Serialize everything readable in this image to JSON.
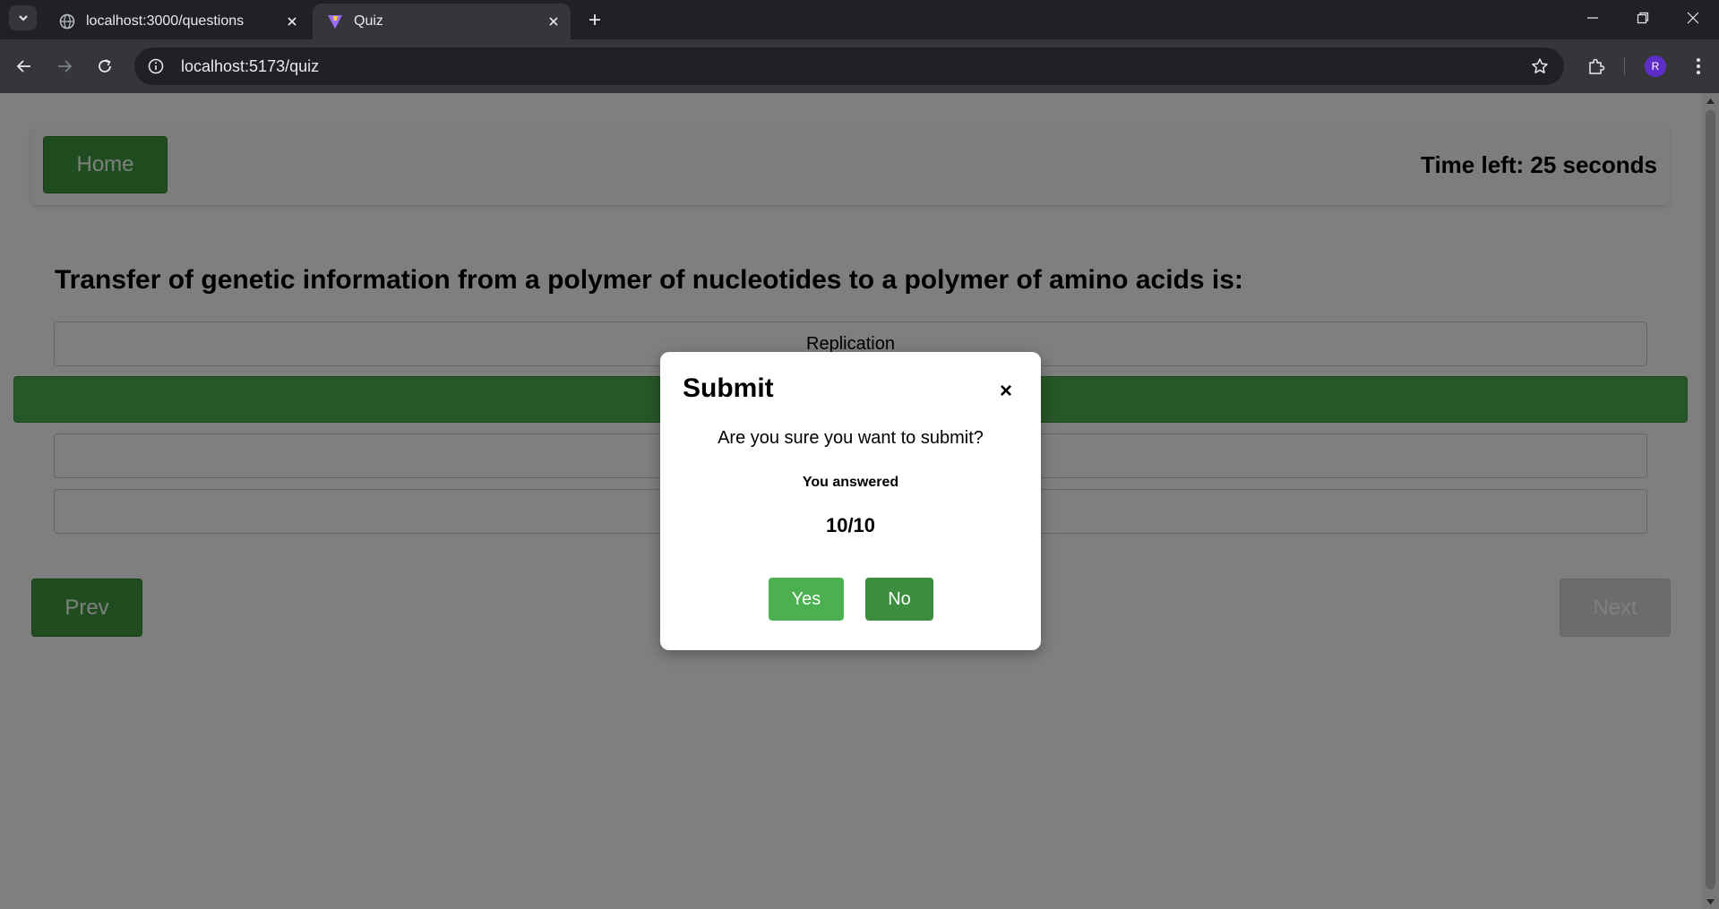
{
  "browser": {
    "tabs": [
      {
        "title": "localhost:3000/questions",
        "favicon": "globe-icon",
        "active": false
      },
      {
        "title": "Quiz",
        "favicon": "vite-logo-icon",
        "active": true
      }
    ],
    "url": "localhost:5173/quiz",
    "profile_initial": "R"
  },
  "page": {
    "home_label": "Home",
    "timer_text": "Time left: 25 seconds",
    "question": "Transfer of genetic information from a polymer of nucleotides to a polymer of amino acids is:",
    "options": [
      {
        "label": "Replication",
        "selected": false
      },
      {
        "label": "",
        "selected": true
      },
      {
        "label": "",
        "selected": false
      },
      {
        "label": "",
        "selected": false
      }
    ],
    "prev_label": "Prev",
    "next_label": "Next"
  },
  "modal": {
    "title": "Submit",
    "close_glyph": "×",
    "message": "Are you sure you want to submit?",
    "answered_label": "You answered",
    "answered_count": "10/10",
    "yes_label": "Yes",
    "no_label": "No"
  },
  "colors": {
    "primary_green": "#4caf50",
    "dark_green": "#3a8e3e",
    "overlay": "rgba(0,0,0,0.5)"
  }
}
